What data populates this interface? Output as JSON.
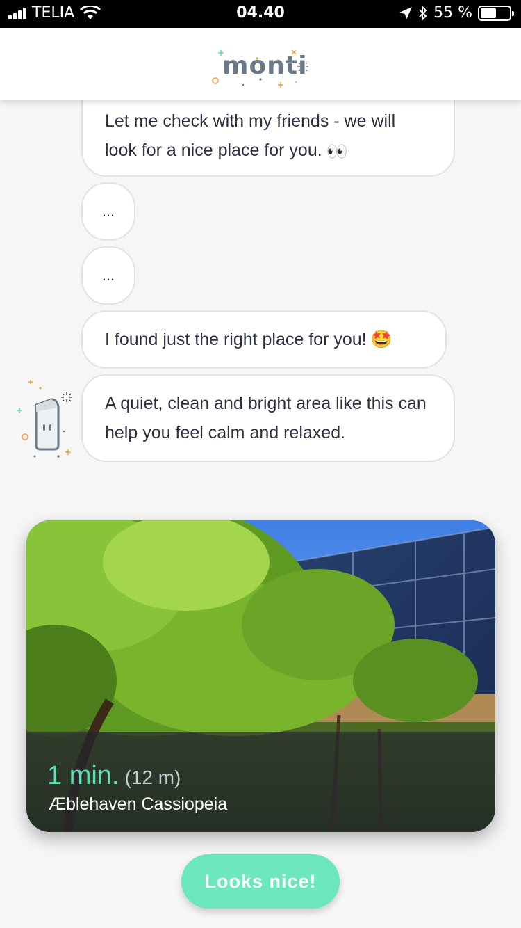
{
  "status_bar": {
    "carrier": "TELIA",
    "time": "04.40",
    "battery_percent_text": "55 %",
    "battery_level": 0.55
  },
  "header": {
    "logo_text": "monti"
  },
  "chat": {
    "messages": [
      {
        "text": "Let me check with my friends - we will look for a nice place for you.",
        "emoji": "👀"
      },
      {
        "text": "..."
      },
      {
        "text": "..."
      },
      {
        "text": "I found just the right place for you!",
        "emoji": "🤩"
      },
      {
        "text": "A quiet, clean and bright area like this can help you feel calm and relaxed."
      }
    ]
  },
  "place_card": {
    "walk_time": "1 min.",
    "distance": "(12 m)",
    "name": "Æblehaven Cassiopeia"
  },
  "actions": {
    "confirm_label": "Looks nice!"
  },
  "colors": {
    "accent": "#6ce6bd",
    "time_text": "#63e0b8",
    "logo": "#6b7a88"
  }
}
